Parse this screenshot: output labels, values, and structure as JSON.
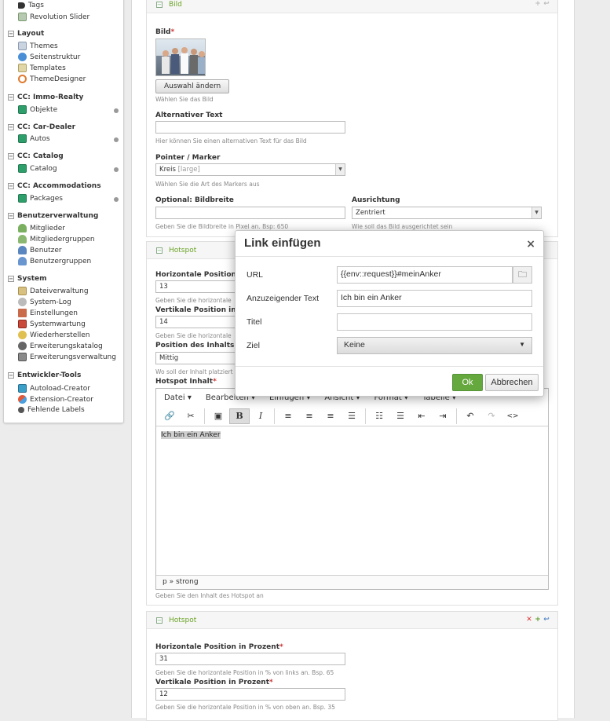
{
  "sidebar": {
    "top_items": [
      {
        "label": "Tags",
        "icon": "tag-icon"
      },
      {
        "label": "Revolution Slider",
        "icon": "slider-icon"
      }
    ],
    "groups": [
      {
        "title": "Layout",
        "items": [
          {
            "label": "Themes"
          },
          {
            "label": "Seitenstruktur"
          },
          {
            "label": "Templates"
          },
          {
            "label": "ThemeDesigner"
          }
        ]
      },
      {
        "title": "CC: Immo-Realty",
        "items": [
          {
            "label": "Objekte"
          }
        ]
      },
      {
        "title": "CC: Car-Dealer",
        "items": [
          {
            "label": "Autos"
          }
        ]
      },
      {
        "title": "CC: Catalog",
        "items": [
          {
            "label": "Catalog"
          }
        ]
      },
      {
        "title": "CC: Accommodations",
        "items": [
          {
            "label": "Packages"
          }
        ]
      },
      {
        "title": "Benutzerverwaltung",
        "items": [
          {
            "label": "Mitglieder"
          },
          {
            "label": "Mitgliedergruppen"
          },
          {
            "label": "Benutzer"
          },
          {
            "label": "Benutzergruppen"
          }
        ]
      },
      {
        "title": "System",
        "items": [
          {
            "label": "Dateiverwaltung"
          },
          {
            "label": "System-Log"
          },
          {
            "label": "Einstellungen"
          },
          {
            "label": "Systemwartung"
          },
          {
            "label": "Wiederherstellen"
          },
          {
            "label": "Erweiterungskatalog"
          },
          {
            "label": "Erweiterungsverwaltung"
          }
        ]
      },
      {
        "title": "Entwickler-Tools",
        "items": [
          {
            "label": "Autoload-Creator"
          },
          {
            "label": "Extension-Creator"
          },
          {
            "label": "Fehlende Labels"
          }
        ]
      }
    ]
  },
  "panel_bild": {
    "title": "Bild",
    "bild_label": "Bild",
    "change_button": "Auswahl ändern",
    "bild_hint": "Wählen Sie das Bild",
    "alt_label": "Alternativer Text",
    "alt_value": "",
    "alt_hint": "Hier können Sie einen alternativen Text für das Bild",
    "pointer_label": "Pointer / Marker",
    "pointer_value": "Kreis",
    "pointer_extra": "[large]",
    "pointer_hint": "Wählen Sie die Art des Markers aus",
    "width_label": "Optional: Bildbreite",
    "width_value": "",
    "width_hint": "Geben Sie die Bildbreite in Pixel an. Bsp: 650",
    "align_label": "Ausrichtung",
    "align_value": "Zentriert",
    "align_hint": "Wie soll das Bild ausgerichtet sein"
  },
  "panel_hotspot1": {
    "title": "Hotspot",
    "hpos_label": "Horizontale Position i",
    "hpos_value": "13",
    "hpos_hint": "Geben Sie die horizontale",
    "vpos_label": "Vertikale Position in P",
    "vpos_value": "14",
    "vpos_hint": "Geben Sie die horizontale",
    "content_pos_label": "Position des Inhalts",
    "content_pos_value": "Mittig",
    "content_pos_hint": "Wo soll der Inhalt platziert",
    "inhalt_label": "Hotspot Inhalt",
    "inhalt_hint": "Geben Sie den Inhalt des Hotspot an"
  },
  "editor": {
    "menu": [
      "Datei ▾",
      "Bearbeiten ▾",
      "Einfügen ▾",
      "Ansicht ▾",
      "Format ▾",
      "Tabelle ▾"
    ],
    "body_text": "Ich bin ein Anker",
    "status": "p » strong"
  },
  "panel_hotspot2": {
    "title": "Hotspot",
    "hpos_label": "Horizontale Position in Prozent",
    "hpos_value": "31",
    "hpos_hint": "Geben Sie die horizontale Position in % von links an. Bsp. 65",
    "vpos_label": "Vertikale Position in Prozent",
    "vpos_value": "12",
    "vpos_hint": "Geben Sie die horizontale Position in % von oben an. Bsp. 35"
  },
  "modal": {
    "title": "Link einfügen",
    "close": "×",
    "url_label": "URL",
    "url_value": "{{env::request}}#meinAnker",
    "text_label": "Anzuzeigender Text",
    "text_value": "Ich bin ein Anker",
    "title_label": "Titel",
    "title_value": "",
    "target_label": "Ziel",
    "target_value": "Keine",
    "ok": "Ok",
    "cancel": "Abbrechen"
  },
  "colors": {
    "accent_green": "#65a83d",
    "panel_title_green": "#6aa325",
    "required_red": "#cc3333"
  }
}
